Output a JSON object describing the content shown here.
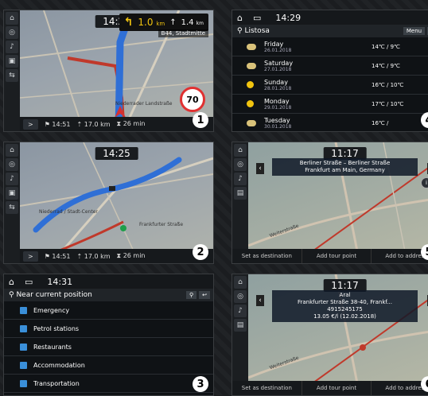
{
  "panels": [
    {
      "number": "1",
      "clock": "14:25",
      "turn_distance": "1.0",
      "turn_distance_unit": "km",
      "next_distance": "1.4",
      "next_distance_unit": "km",
      "street": "B44, Stadtmitte",
      "map_label": "Niederrader Landstraße",
      "speed_limit": "70",
      "bottom": {
        "time": "14:51",
        "distance": "17.0 km",
        "duration": "26 min"
      }
    },
    {
      "number": "2",
      "clock": "14:25",
      "map_label1": "Niederrad / Stadt-Center",
      "map_label2": "Frankfurter Straße",
      "bottom": {
        "time": "14:51",
        "distance": "17.0 km",
        "duration": "26 min"
      }
    },
    {
      "number": "3",
      "clock": "14:31",
      "heading": "Near current position",
      "items": [
        "Emergency",
        "Petrol stations",
        "Restaurants",
        "Accommodation",
        "Transportation"
      ]
    },
    {
      "number": "4",
      "clock": "14:29",
      "heading": "Listosa",
      "btn_menu": "Menu",
      "days": [
        {
          "day": "Friday",
          "date": "26.01.2018",
          "temp": "14℃ / 9℃",
          "icon": "cloud"
        },
        {
          "day": "Saturday",
          "date": "27.01.2018",
          "temp": "14℃ / 9℃",
          "icon": "cloud"
        },
        {
          "day": "Sunday",
          "date": "28.01.2018",
          "temp": "16℃ / 10℃",
          "icon": "sun"
        },
        {
          "day": "Monday",
          "date": "29.01.2018",
          "temp": "17℃ / 10℃",
          "icon": "sun"
        },
        {
          "day": "Tuesday",
          "date": "30.01.2018",
          "temp": "16℃ / ",
          "icon": "cloud"
        }
      ]
    },
    {
      "number": "5",
      "clock": "11:17",
      "info_line1": "Berliner Straße – Berliner Straße",
      "info_line2": "Frankfurt am Main, Germany",
      "map_label": "Weiterstraße",
      "buttons": [
        "Set as destination",
        "Add tour point",
        "Add to address"
      ]
    },
    {
      "number": "6",
      "clock": "11:17",
      "info_line1": "Aral",
      "info_line2": "Frankfurter Straße 38-40, Frankf...",
      "info_line3": "4915245175",
      "info_line4": "13.05 €/l (12.02.2018)",
      "map_label": "Weiterstraße",
      "buttons": [
        "Set as destination",
        "Add tour point",
        "Add to address"
      ]
    }
  ]
}
